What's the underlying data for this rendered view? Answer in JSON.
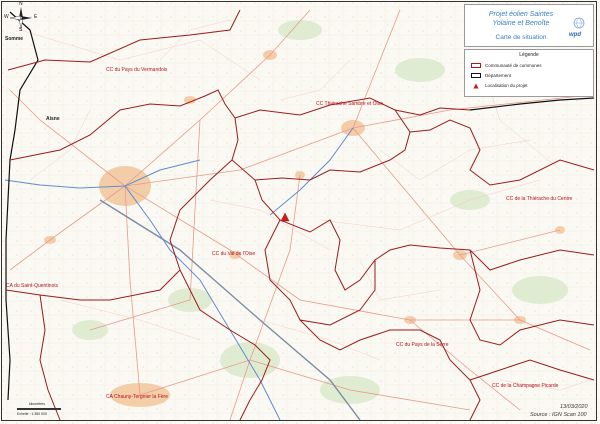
{
  "title": {
    "line1": "Projet éolien Saintes",
    "line2": "Yolaine et Benoîte",
    "subtitle": "Carte de situation"
  },
  "logo": {
    "text": "wpd"
  },
  "legend": {
    "title": "Légende",
    "items": [
      {
        "symbol": "outline-red",
        "label": "Communauté de communes"
      },
      {
        "symbol": "outline-black",
        "label": "Département"
      },
      {
        "symbol": "triangle-red",
        "label": "Localisation du projet"
      }
    ]
  },
  "compass": {
    "n": "N",
    "s": "S",
    "e": "E",
    "w": "W"
  },
  "scale": {
    "label": "kilomètres",
    "echelle": "Echelle : 1:350 000"
  },
  "footer": {
    "date": "13/03/2020",
    "source": "Source : IGN Scan 100"
  },
  "departments": {
    "somme": "Somme",
    "aisne": "Aisne"
  },
  "cc_labels": {
    "vermandois": "CC du Pays du Vermandois",
    "thierache_sambre": "CC Thiérache Sambre et Oise",
    "thierache_centre": "CC de la Thiérache du Centre",
    "val_oise": "CC du Val de l'Oise",
    "saint_quentinois": "CA du Saint-Quentinois",
    "pays_serre": "CC du Pays de la Serre",
    "chauny": "CA Chauny-Tergnier la Fère",
    "champagne": "CC de la Champagne Picarde"
  },
  "colors": {
    "cc_border": "#b5121b",
    "dept_border": "#111111",
    "river": "#5f8ccf",
    "road": "#e89a8a",
    "urban": "#f2c9a0",
    "project_marker": "#d01a1a",
    "title_text": "#3b7fc4"
  }
}
